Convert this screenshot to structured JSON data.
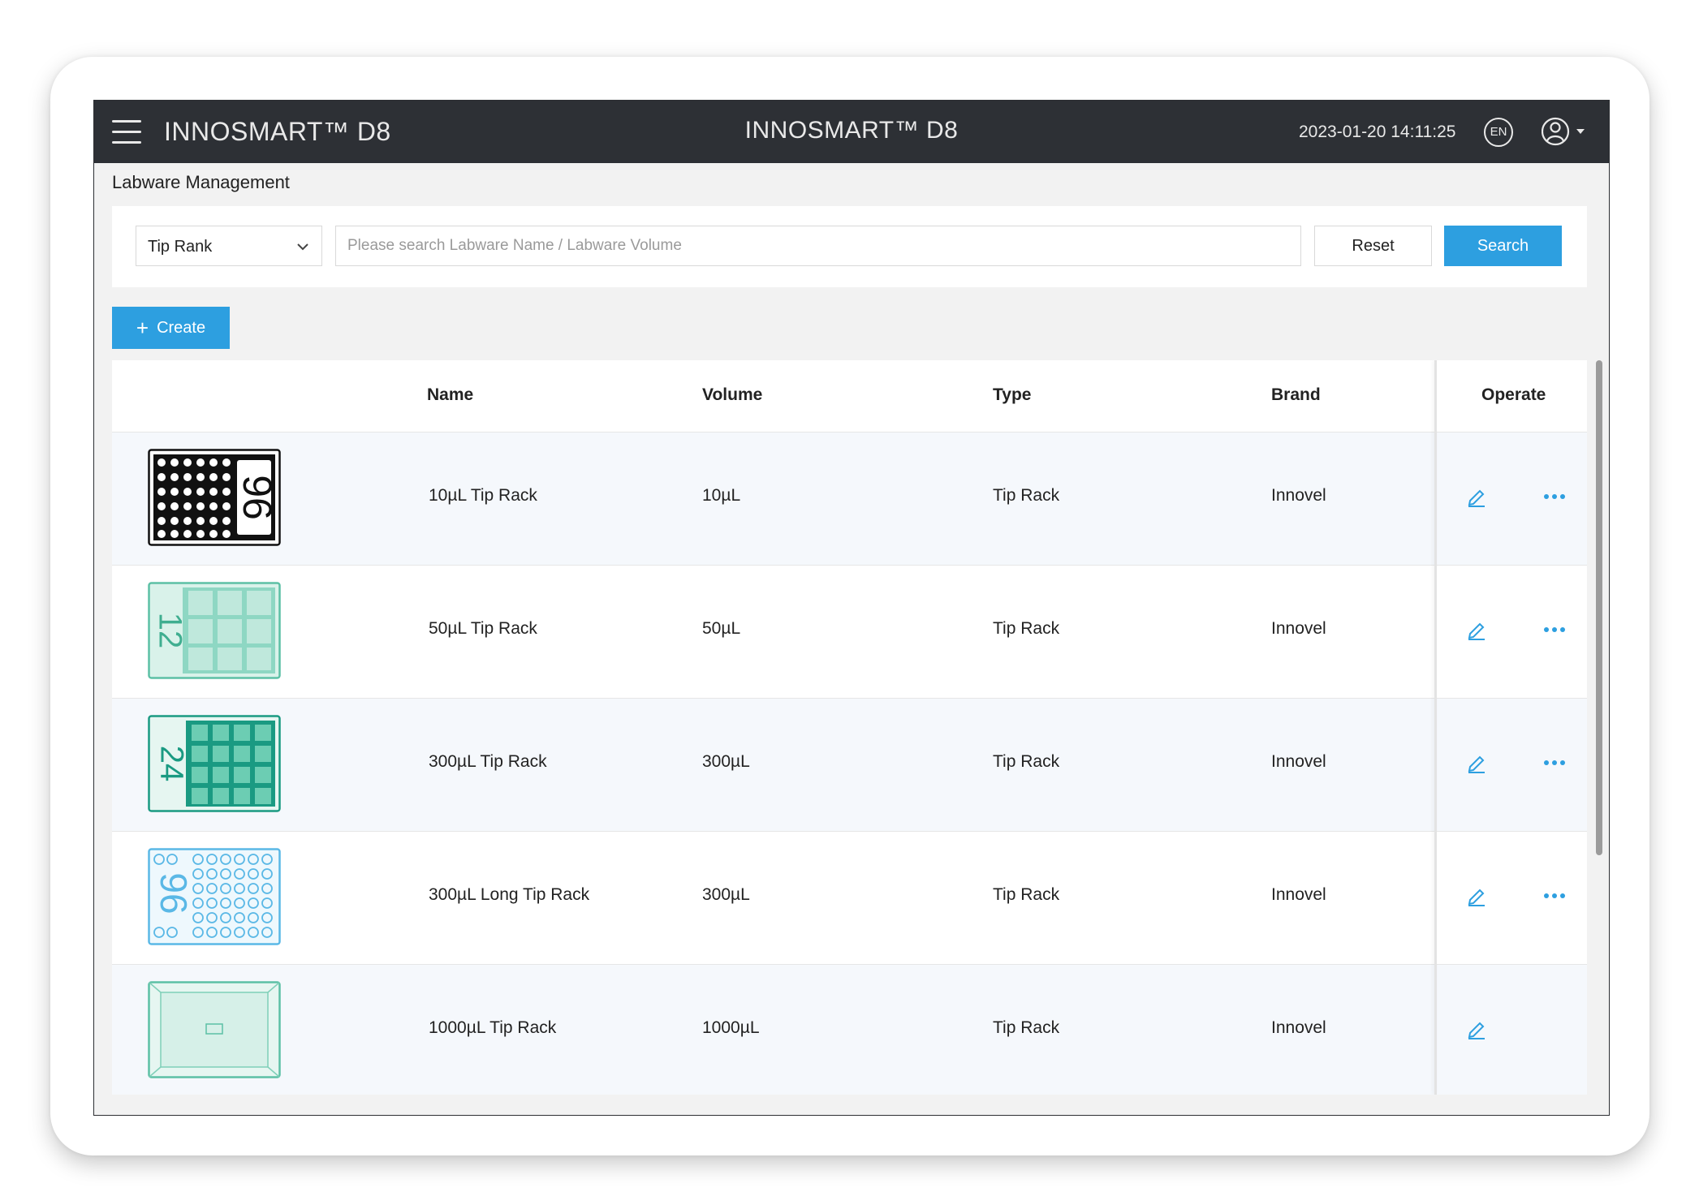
{
  "header": {
    "brand_left": "INNOSMART™ D8",
    "brand_center": "INNOSMART™ D8",
    "datetime": "2023-01-20 14:11:25",
    "language": "EN"
  },
  "page": {
    "title": "Labware Management"
  },
  "search": {
    "category_selected": "Tip Rank",
    "placeholder": "Please search Labware Name / Labware Volume",
    "value": "",
    "reset_label": "Reset",
    "search_label": "Search"
  },
  "actions": {
    "create_label": "Create"
  },
  "table": {
    "columns": [
      "Name",
      "Volume",
      "Type",
      "Brand",
      "Operate"
    ],
    "rows": [
      {
        "name": "10µL Tip Rack",
        "volume": "10µL",
        "type": "Tip Rack",
        "brand": "Innovel",
        "thumb_label": "96",
        "has_more": true
      },
      {
        "name": "50µL Tip Rack",
        "volume": "50µL",
        "type": "Tip Rack",
        "brand": "Innovel",
        "thumb_label": "12",
        "has_more": true
      },
      {
        "name": "300µL Tip Rack",
        "volume": "300µL",
        "type": "Tip Rack",
        "brand": "Innovel",
        "thumb_label": "24",
        "has_more": true
      },
      {
        "name": "300µL Long Tip Rack",
        "volume": "300µL",
        "type": "Tip Rack",
        "brand": "Innovel",
        "thumb_label": "96",
        "has_more": true
      },
      {
        "name": "1000µL Tip Rack",
        "volume": "1000µL",
        "type": "Tip Rack",
        "brand": "Innovel",
        "thumb_label": "",
        "has_more": false
      }
    ]
  },
  "colors": {
    "topbar": "#2d3035",
    "accent": "#2d9fe0",
    "thumb_black": "#111111",
    "thumb_teal": "#5cc0a5",
    "thumb_teal_dark": "#1a9a82",
    "thumb_blue": "#5ab8e6"
  }
}
